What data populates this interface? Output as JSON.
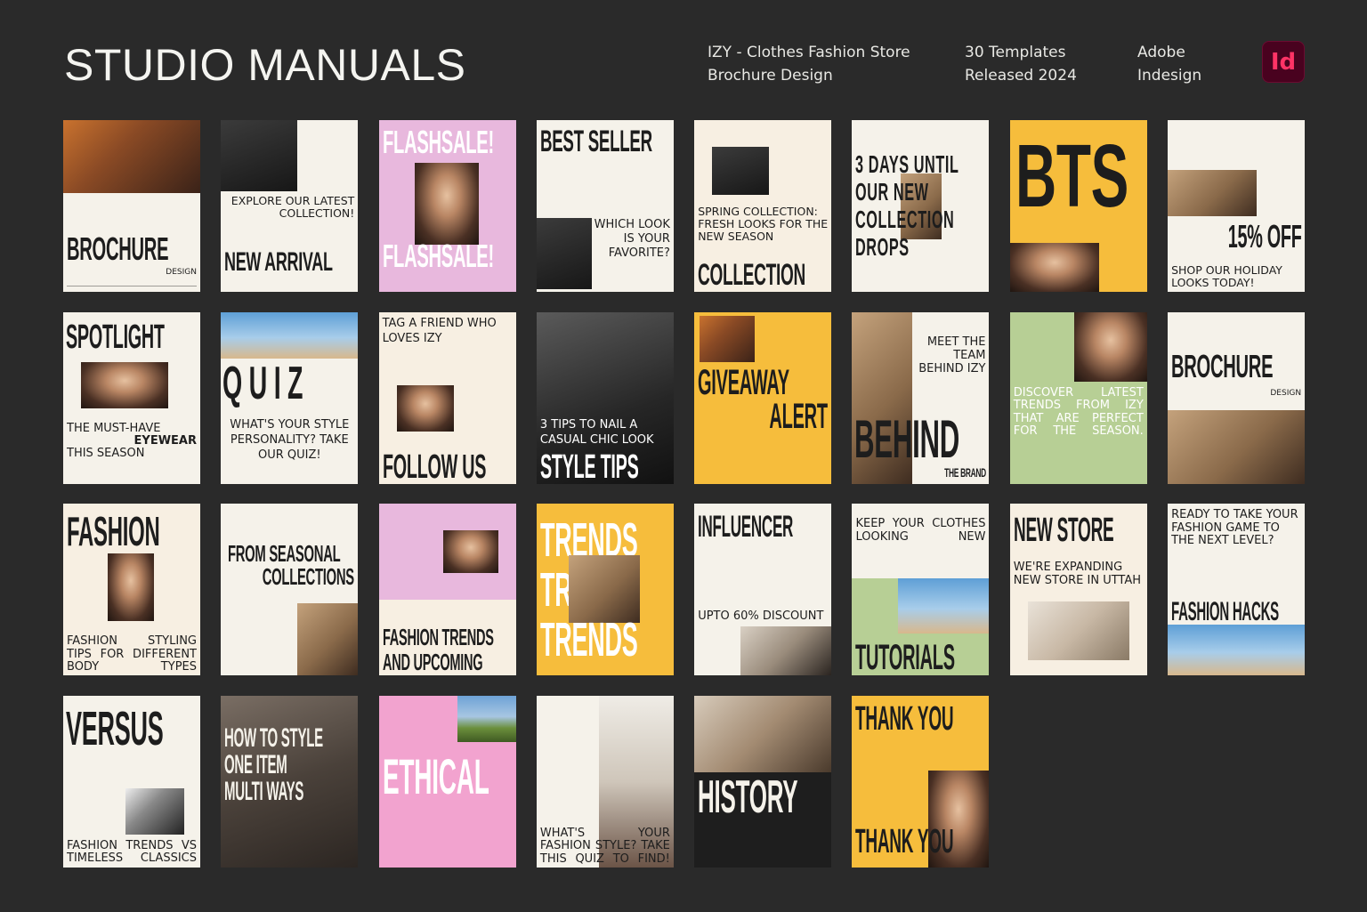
{
  "header": {
    "title": "STUDIO MANUALS",
    "product_line1": "IZY - Clothes Fashion Store",
    "product_line2": "Brochure Design",
    "templates_line1": "30 Templates",
    "templates_line2": "Released 2024",
    "app_line1": "Adobe",
    "app_line2": "Indesign",
    "app_icon": "Id"
  },
  "colors": {
    "background": "#2a2a2a",
    "cream": "#f5f2ea",
    "pink": "#e8b8dd",
    "yellow": "#f6bd3c",
    "green": "#b7cf95",
    "hot_pink": "#f2a3cf",
    "ink": "#1d1d1d",
    "indesign": "#49021f"
  },
  "cards": [
    {
      "big": "BROCHURE",
      "small": "DESIGN"
    },
    {
      "big": "NEW ARRIVAL",
      "small": "EXPLORE OUR LATEST COLLECTION!"
    },
    {
      "big": "FLASHSALE!",
      "big2": "FLASHSALE!"
    },
    {
      "big": "BEST SELLER",
      "small": "WHICH LOOK IS YOUR FAVORITE?"
    },
    {
      "big": "COLLECTION",
      "small": "SPRING COLLECTION: FRESH LOOKS FOR THE NEW SEASON"
    },
    {
      "big": "3 DAYS UNTIL OUR NEW COLLECTION DROPS"
    },
    {
      "big": "BTS"
    },
    {
      "big": "15% OFF",
      "small": "SHOP OUR HOLIDAY LOOKS TODAY!"
    },
    {
      "big": "SPOTLIGHT",
      "small": "THE MUST-HAVE",
      "small2": "EYEWEAR",
      "small3": "THIS SEASON"
    },
    {
      "big": "Q U I Z",
      "small": "WHAT'S YOUR STYLE PERSONALITY? TAKE OUR QUIZ!"
    },
    {
      "big": "FOLLOW US",
      "small": "TAG A FRIEND WHO LOVES IZY"
    },
    {
      "big": "STYLE TIPS",
      "small": "3 TIPS TO NAIL A CASUAL CHIC LOOK"
    },
    {
      "big": "GIVEAWAY",
      "big2": "ALERT"
    },
    {
      "big": "BEHIND",
      "small": "MEET THE TEAM BEHIND IZY",
      "small2": "THE BRAND"
    },
    {
      "small": "DISCOVER LATEST TRENDS FROM IZY THAT ARE PERFECT FOR THE SEASON."
    },
    {
      "big": "BROCHURE",
      "small": "DESIGN"
    },
    {
      "big": "FASHION",
      "small": "FASHION STYLING TIPS FOR DIFFERENT BODY TYPES"
    },
    {
      "big": "FROM SEASONAL",
      "big2": "COLLECTIONS"
    },
    {
      "big": "FASHION TRENDS",
      "big2": "AND UPCOMING"
    },
    {
      "big": "TRENDS",
      "big2": "TRENDS",
      "big3": "TRENDS"
    },
    {
      "big": "INFLUENCER",
      "small": "UPTO 60% DISCOUNT"
    },
    {
      "big": "TUTORIALS",
      "small": "KEEP YOUR CLOTHES LOOKING NEW"
    },
    {
      "big": "NEW STORE",
      "small": "WE'RE EXPANDING NEW STORE IN UTTAH"
    },
    {
      "big": "FASHION HACKS",
      "small": "READY TO TAKE YOUR FASHION GAME TO THE NEXT LEVEL?"
    },
    {
      "big": "VERSUS",
      "small": "FASHION TRENDS VS TIMELESS CLASSICS"
    },
    {
      "big": "HOW TO STYLE",
      "big2": "ONE ITEM",
      "big3": "MULTI WAYS"
    },
    {
      "big": "ETHICAL"
    },
    {
      "small": "WHAT'S YOUR FASHION STYLE? TAKE THIS QUIZ TO FIND!"
    },
    {
      "big": "HISTORY"
    },
    {
      "big": "THANK YOU",
      "big2": "THANK YOU"
    }
  ]
}
